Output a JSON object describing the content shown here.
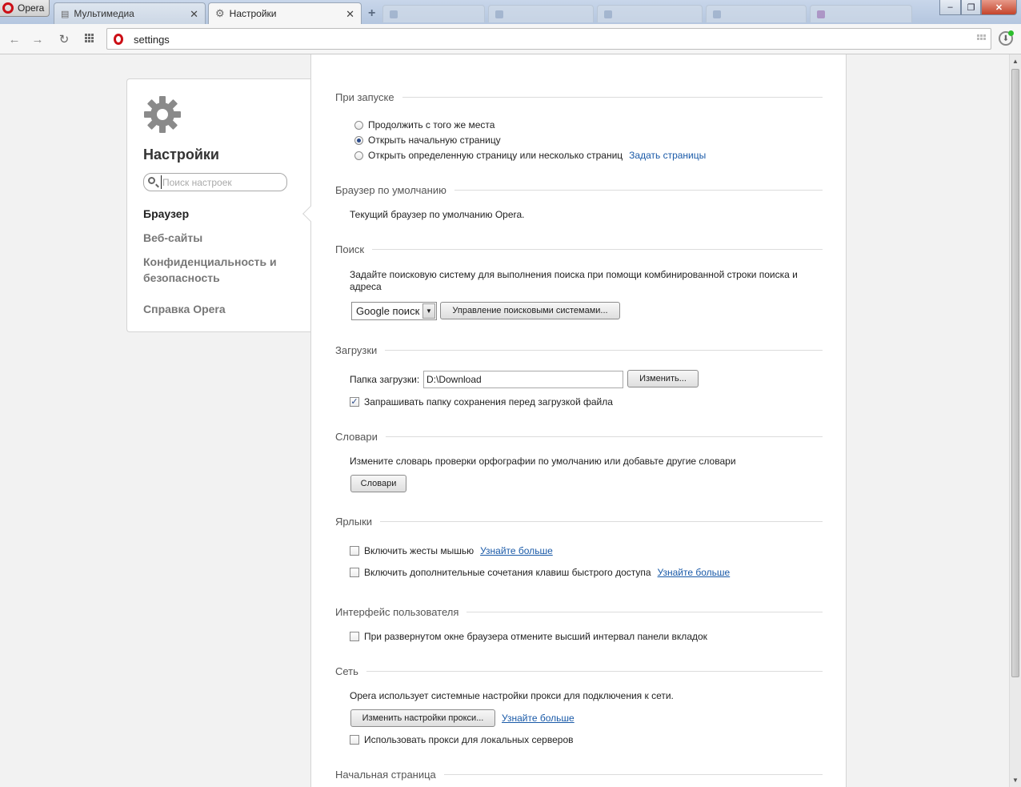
{
  "browser": {
    "menu_label": "Opera",
    "tabs": [
      {
        "label": "Мультимедиа",
        "close": "✕"
      },
      {
        "label": "Настройки",
        "close": "✕"
      }
    ],
    "new_tab_symbol": "+",
    "window_controls": {
      "minimize": "–",
      "maximize": "❐",
      "close": "✕"
    }
  },
  "toolbar": {
    "back": "←",
    "forward": "→",
    "reload": "↻",
    "address": "settings",
    "download_icon": "⬇"
  },
  "sidebar": {
    "title": "Настройки",
    "search_placeholder": "Поиск настроек",
    "items": [
      {
        "label": "Браузер"
      },
      {
        "label": "Веб-сайты"
      },
      {
        "label": "Конфиденциальность и"
      },
      {
        "label": "безопасность"
      },
      {
        "label": "Справка Opera"
      }
    ],
    "active_item": "Браузер"
  },
  "startup": {
    "heading": "При запуске",
    "options": [
      {
        "label": "Продолжить с того же места",
        "selected": false
      },
      {
        "label": "Открыть начальную страницу",
        "selected": true
      },
      {
        "label": "Открыть определенную страницу или несколько страниц",
        "selected": false
      }
    ],
    "set_pages_link": "Задать страницы"
  },
  "default_browser": {
    "heading": "Браузер по умолчанию",
    "text": "Текущий браузер по умолчанию Opera."
  },
  "search": {
    "heading": "Поиск",
    "text_line1": "Задайте поисковую систему для выполнения поиска при помощи комбинированной строки поиска и",
    "text_line2": "адреса",
    "engine_selected": "Google поиск",
    "manage_button": "Управление поисковыми системами..."
  },
  "downloads": {
    "heading": "Загрузки",
    "folder_label": "Папка загрузки:",
    "folder_value": "D:\\Download",
    "change_button": "Изменить...",
    "ask_checkbox": {
      "label": "Запрашивать папку сохранения перед загрузкой файла",
      "checked": true
    }
  },
  "dictionaries": {
    "heading": "Словари",
    "text": "Измените словарь проверки орфографии по умолчанию или добавьте другие словари",
    "button": "Словари"
  },
  "shortcuts": {
    "heading": "Ярлыки",
    "gestures": {
      "label": "Включить жесты мышью",
      "checked": false,
      "link": "Узнайте больше"
    },
    "advanced_keys": {
      "label": "Включить дополнительные сочетания клавиш быстрого доступа",
      "checked": false,
      "link": "Узнайте больше"
    }
  },
  "ui": {
    "heading": "Интерфейс пользователя",
    "tab_spacing": {
      "label": "При развернутом окне браузера отмените высший интервал панели вкладок",
      "checked": false
    }
  },
  "network": {
    "heading": "Сеть",
    "text": "Opera использует системные настройки прокси для подключения к сети.",
    "proxy_button": "Изменить настройки прокси...",
    "learn_more": "Узнайте больше",
    "local_proxy": {
      "label": "Использовать прокси для локальных серверов",
      "checked": false
    }
  },
  "homepage": {
    "heading": "Начальная страница"
  },
  "colors": {
    "accent_link": "#1a5aa8",
    "opera_red": "#cc0f16"
  }
}
